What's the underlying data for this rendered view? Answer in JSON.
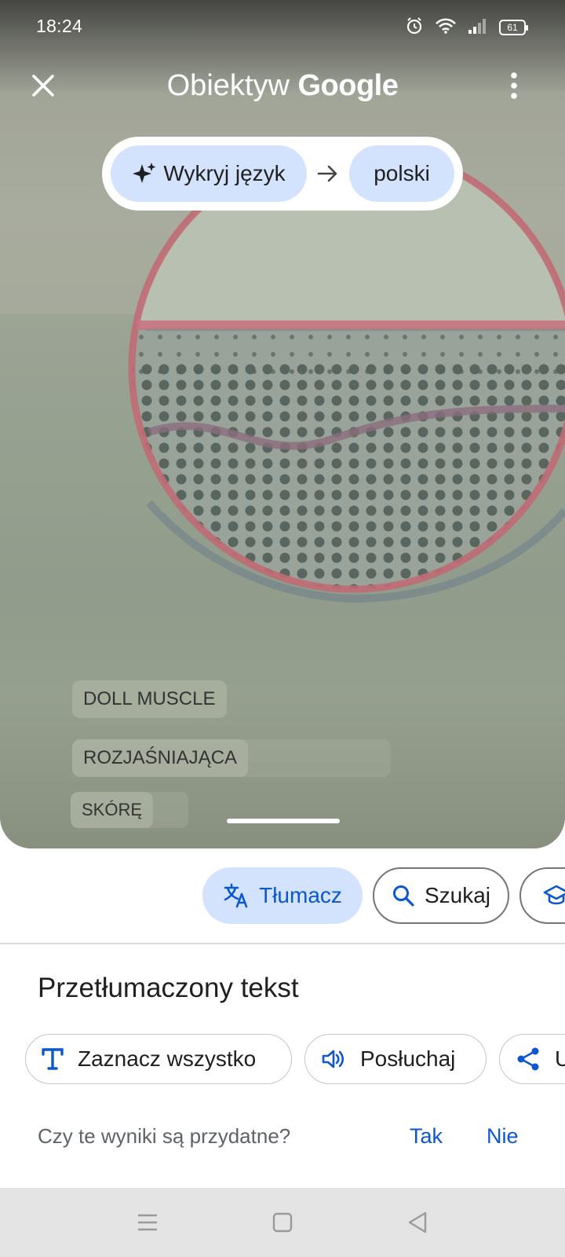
{
  "status_bar": {
    "time": "18:24",
    "battery": "61",
    "icons": [
      "alarm-icon",
      "wifi-icon",
      "signal-icon",
      "battery-icon"
    ]
  },
  "app_bar": {
    "title_prefix": "Obiektyw",
    "title_brand": "Google",
    "close_icon": "close-icon",
    "more_icon": "more-vert-icon"
  },
  "language": {
    "source": "Wykryj język",
    "source_icon": "sparkle-icon",
    "arrow_icon": "arrow-right-icon",
    "target": "polski"
  },
  "overlay_text": {
    "line1": "DOLL MUSCLE",
    "line2": "ROZJAŚNIAJĄCA",
    "line3": "SKÓRĘ"
  },
  "mode_chips": {
    "translate": "Tłumacz",
    "search": "Szukaj",
    "homework_icon": "school-icon"
  },
  "results": {
    "title": "Przetłumaczony tekst",
    "select_all": "Zaznacz wszystko",
    "listen": "Posłuchaj",
    "share_partial": "U"
  },
  "feedback": {
    "question": "Czy te wyniki są przydatne?",
    "yes": "Tak",
    "no": "Nie"
  },
  "nav": {
    "icons": [
      "menu-icon",
      "home-square-icon",
      "back-triangle-icon"
    ]
  },
  "colors": {
    "accent": "#0b57d0",
    "chip_selected_bg": "#d3e3fd",
    "camera_ring": "#c8707a"
  }
}
